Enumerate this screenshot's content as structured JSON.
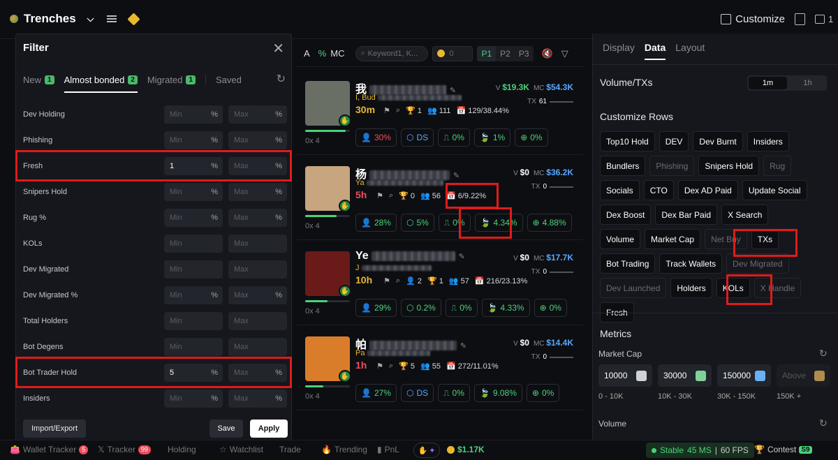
{
  "topbar": {
    "brand": "Trenches",
    "customize": "Customize",
    "count": "1"
  },
  "filter": {
    "title": "Filter",
    "tabs": [
      {
        "label": "New",
        "badge": "1"
      },
      {
        "label": "Almost bonded",
        "badge": "2"
      },
      {
        "label": "Migrated",
        "badge": "1"
      },
      {
        "label": "Saved",
        "badge": ""
      }
    ],
    "min_placeholder": "Min",
    "max_placeholder": "Max",
    "pct": "%",
    "rows": [
      {
        "label": "Dev Holding",
        "min": "",
        "pct": true
      },
      {
        "label": "Phishing",
        "min": "",
        "pct": true
      },
      {
        "label": "Fresh",
        "min": "1",
        "pct": true
      },
      {
        "label": "Snipers Hold",
        "min": "",
        "pct": true
      },
      {
        "label": "Rug %",
        "min": "",
        "pct": true
      },
      {
        "label": "KOLs",
        "min": "",
        "pct": false
      },
      {
        "label": "Dev Migrated",
        "min": "",
        "pct": false
      },
      {
        "label": "Dev Migrated %",
        "min": "",
        "pct": true
      },
      {
        "label": "Total Holders",
        "min": "",
        "pct": false
      },
      {
        "label": "Bot Degens",
        "min": "",
        "pct": false
      },
      {
        "label": "Bot Trader Hold",
        "min": "5",
        "pct": true
      },
      {
        "label": "Insiders",
        "min": "",
        "pct": true
      }
    ],
    "import_export": "Import/Export",
    "save": "Save",
    "apply": "Apply"
  },
  "column": {
    "a": "A",
    "pct": "%",
    "mc": "MC",
    "keyword_placeholder": "Keyword1, K...",
    "coin_value": "0",
    "pages": [
      "P1",
      "P2",
      "P3"
    ]
  },
  "tokens": [
    {
      "name": "我",
      "sub": "I, Bud",
      "age": "30m",
      "age_red": false,
      "v": "$19.3K",
      "mc": "$54.3K",
      "tx": "61",
      "stats": [
        "1",
        "111",
        "129/38.44%"
      ],
      "addr": "0x        4",
      "pills": [
        {
          "t": "30%",
          "c": "red"
        },
        {
          "t": "DS",
          "c": "blue"
        },
        {
          "t": "0%",
          "c": ""
        },
        {
          "t": "1%",
          "c": ""
        },
        {
          "t": "0%",
          "c": ""
        }
      ],
      "bar": 0.9,
      "bg": "#6a6f66"
    },
    {
      "name": "杨",
      "sub": "Ya",
      "age": "5h",
      "age_red": true,
      "v": "$0",
      "mc": "$36.2K",
      "tx": "0",
      "stats": [
        "0",
        "56",
        "6/9.22%"
      ],
      "addr": "0x        4",
      "pills": [
        {
          "t": "28%",
          "c": ""
        },
        {
          "t": "5%",
          "c": ""
        },
        {
          "t": "0%",
          "c": ""
        },
        {
          "t": "4.34%",
          "c": ""
        },
        {
          "t": "4.88%",
          "c": ""
        }
      ],
      "bar": 0.7,
      "bg": "#c7a57e"
    },
    {
      "name": "Ye",
      "sub": "J",
      "age": "10h",
      "age_red": false,
      "v": "$0",
      "mc": "$17.7K",
      "tx": "0",
      "stats": [
        "2",
        "1",
        "57",
        "216/23.13%"
      ],
      "addr": "0x        4",
      "pills": [
        {
          "t": "29%",
          "c": ""
        },
        {
          "t": "0.2%",
          "c": ""
        },
        {
          "t": "0%",
          "c": ""
        },
        {
          "t": "4.33%",
          "c": ""
        },
        {
          "t": "0%",
          "c": ""
        }
      ],
      "bar": 0.5,
      "bg": "#6b1a1a"
    },
    {
      "name": "帕",
      "sub": "Pa",
      "age": "1h",
      "age_red": true,
      "v": "$0",
      "mc": "$14.4K",
      "tx": "0",
      "stats": [
        "5",
        "55",
        "272/11.01%"
      ],
      "addr": "0x        4",
      "pills": [
        {
          "t": "27%",
          "c": ""
        },
        {
          "t": "DS",
          "c": "blue"
        },
        {
          "t": "0%",
          "c": ""
        },
        {
          "t": "9.08%",
          "c": ""
        },
        {
          "t": "0%",
          "c": ""
        }
      ],
      "bar": 0.4,
      "bg": "#d97d2b"
    }
  ],
  "right": {
    "tabs": [
      "Display",
      "Data",
      "Layout"
    ],
    "vt_title": "Volume/TXs",
    "seg": [
      "1m",
      "1h"
    ],
    "cr_title": "Customize Rows",
    "chips": [
      {
        "t": "Top10 Hold",
        "off": false
      },
      {
        "t": "DEV",
        "off": false
      },
      {
        "t": "Dev Burnt",
        "off": false
      },
      {
        "t": "Insiders",
        "off": false
      },
      {
        "t": "Bundlers",
        "off": false
      },
      {
        "t": "Phishing",
        "off": true
      },
      {
        "t": "Snipers Hold",
        "off": false
      },
      {
        "t": "Rug",
        "off": true
      },
      {
        "t": "Socials",
        "off": false
      },
      {
        "t": "CTO",
        "off": false
      },
      {
        "t": "Dex AD Paid",
        "off": false
      },
      {
        "t": "Update Social",
        "off": false
      },
      {
        "t": "Dex Boost",
        "off": false
      },
      {
        "t": "Dex Bar Paid",
        "off": false
      },
      {
        "t": "X Search",
        "off": false
      },
      {
        "t": "Volume",
        "off": false
      },
      {
        "t": "Market Cap",
        "off": false
      },
      {
        "t": "Net Buy",
        "off": true
      },
      {
        "t": "TXs",
        "off": false
      },
      {
        "t": "Bot Trading",
        "off": false
      },
      {
        "t": "Track Wallets",
        "off": false
      },
      {
        "t": "Dev Migrated",
        "off": true
      },
      {
        "t": "Dev Launched",
        "off": true
      },
      {
        "t": "Holders",
        "off": false
      },
      {
        "t": "KOLs",
        "off": false
      },
      {
        "t": "X Handle",
        "off": true
      },
      {
        "t": "Fresh",
        "off": false
      }
    ],
    "metrics_title": "Metrics",
    "market_cap_title": "Market Cap",
    "mc_values": [
      {
        "v": "10000",
        "sw": "#cfd2d6",
        "dim": false
      },
      {
        "v": "30000",
        "sw": "#7fd39a",
        "dim": false
      },
      {
        "v": "150000",
        "sw": "#6ab0f3",
        "dim": false
      },
      {
        "v": "Above",
        "sw": "#b08a4e",
        "dim": true
      }
    ],
    "mc_ranges": [
      "0 - 10K",
      "10K - 30K",
      "30K - 150K",
      "150K +"
    ],
    "volume_title": "Volume"
  },
  "bottom": {
    "wallet_tracker": "Wallet Tracker",
    "wallet_badge": "5",
    "tracker": "Tracker",
    "tracker_badge": "99",
    "holding": "Holding",
    "watchlist": "Watchlist",
    "trade": "Trade",
    "trending": "Trending",
    "pnl": "PnL",
    "money": "$1.17K",
    "stable": "Stable",
    "ms": "45 MS",
    "fps": "60 FPS",
    "contest": "Contest",
    "s9": "S9"
  }
}
